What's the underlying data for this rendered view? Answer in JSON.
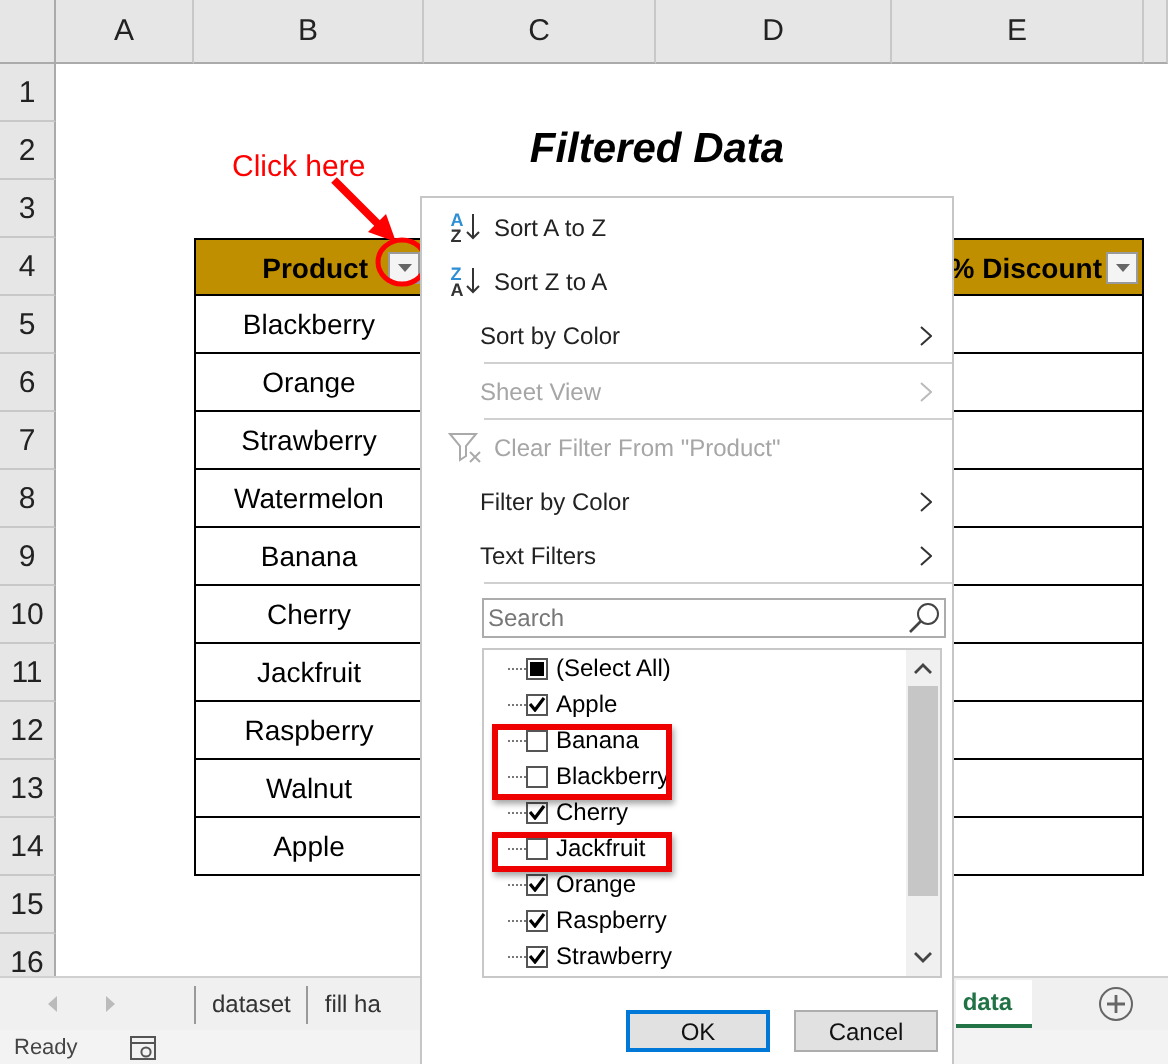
{
  "sheet": {
    "columns": [
      "A",
      "B",
      "C",
      "D",
      "E"
    ],
    "rows": [
      "1",
      "2",
      "3",
      "4",
      "5",
      "6",
      "7",
      "8",
      "9",
      "10",
      "11",
      "12",
      "13",
      "14",
      "15",
      "16"
    ],
    "title": "Filtered Data",
    "table": {
      "header": "Product",
      "rows": [
        "Blackberry",
        "Orange",
        "Strawberry",
        "Watermelon",
        "Banana",
        "Cherry",
        "Jackfruit",
        "Raspberry",
        "Walnut",
        "Apple"
      ]
    },
    "discount_header": "% Discount"
  },
  "annotation": {
    "text": "Click here"
  },
  "filter_menu": {
    "items": [
      {
        "kind": "sort",
        "icon_text": "AZ",
        "label": "Sort A to Z",
        "disabled": false,
        "submenu": false,
        "separator_after": false
      },
      {
        "kind": "sort",
        "icon_text": "ZA",
        "label": "Sort Z to A",
        "disabled": false,
        "submenu": false,
        "separator_after": false
      },
      {
        "kind": "plain",
        "label": "Sort by Color",
        "disabled": false,
        "submenu": true,
        "separator_after": true
      },
      {
        "kind": "plain",
        "label": "Sheet View",
        "disabled": true,
        "submenu": true,
        "separator_after": true
      },
      {
        "kind": "clear",
        "label": "Clear Filter From \"Product\"",
        "disabled": true,
        "submenu": false,
        "separator_after": false
      },
      {
        "kind": "plain",
        "label": "Filter by Color",
        "disabled": false,
        "submenu": true,
        "separator_after": false
      },
      {
        "kind": "plain",
        "label": "Text Filters",
        "disabled": false,
        "submenu": true,
        "separator_after": true
      }
    ],
    "search": {
      "placeholder": "Search"
    },
    "checklist": [
      {
        "label": "(Select All)",
        "checked": false,
        "partial": true,
        "highlighted": false
      },
      {
        "label": "Apple",
        "checked": true,
        "partial": false,
        "highlighted": false
      },
      {
        "label": "Banana",
        "checked": false,
        "partial": false,
        "highlighted": true
      },
      {
        "label": "Blackberry",
        "checked": false,
        "partial": false,
        "highlighted": true
      },
      {
        "label": "Cherry",
        "checked": true,
        "partial": false,
        "highlighted": false
      },
      {
        "label": "Jackfruit",
        "checked": false,
        "partial": false,
        "highlighted": true
      },
      {
        "label": "Orange",
        "checked": true,
        "partial": false,
        "highlighted": false
      },
      {
        "label": "Raspberry",
        "checked": true,
        "partial": false,
        "highlighted": false
      },
      {
        "label": "Strawberry",
        "checked": true,
        "partial": false,
        "highlighted": false
      }
    ],
    "buttons": [
      {
        "label": "OK",
        "default": true
      },
      {
        "label": "Cancel",
        "default": false
      }
    ]
  },
  "sheet_tabs": [
    {
      "label": "dataset",
      "selected": false
    },
    {
      "label": "fill ha",
      "selected": false
    },
    {
      "label": "data",
      "selected": true
    }
  ],
  "status_bar": {
    "text": "Ready"
  }
}
